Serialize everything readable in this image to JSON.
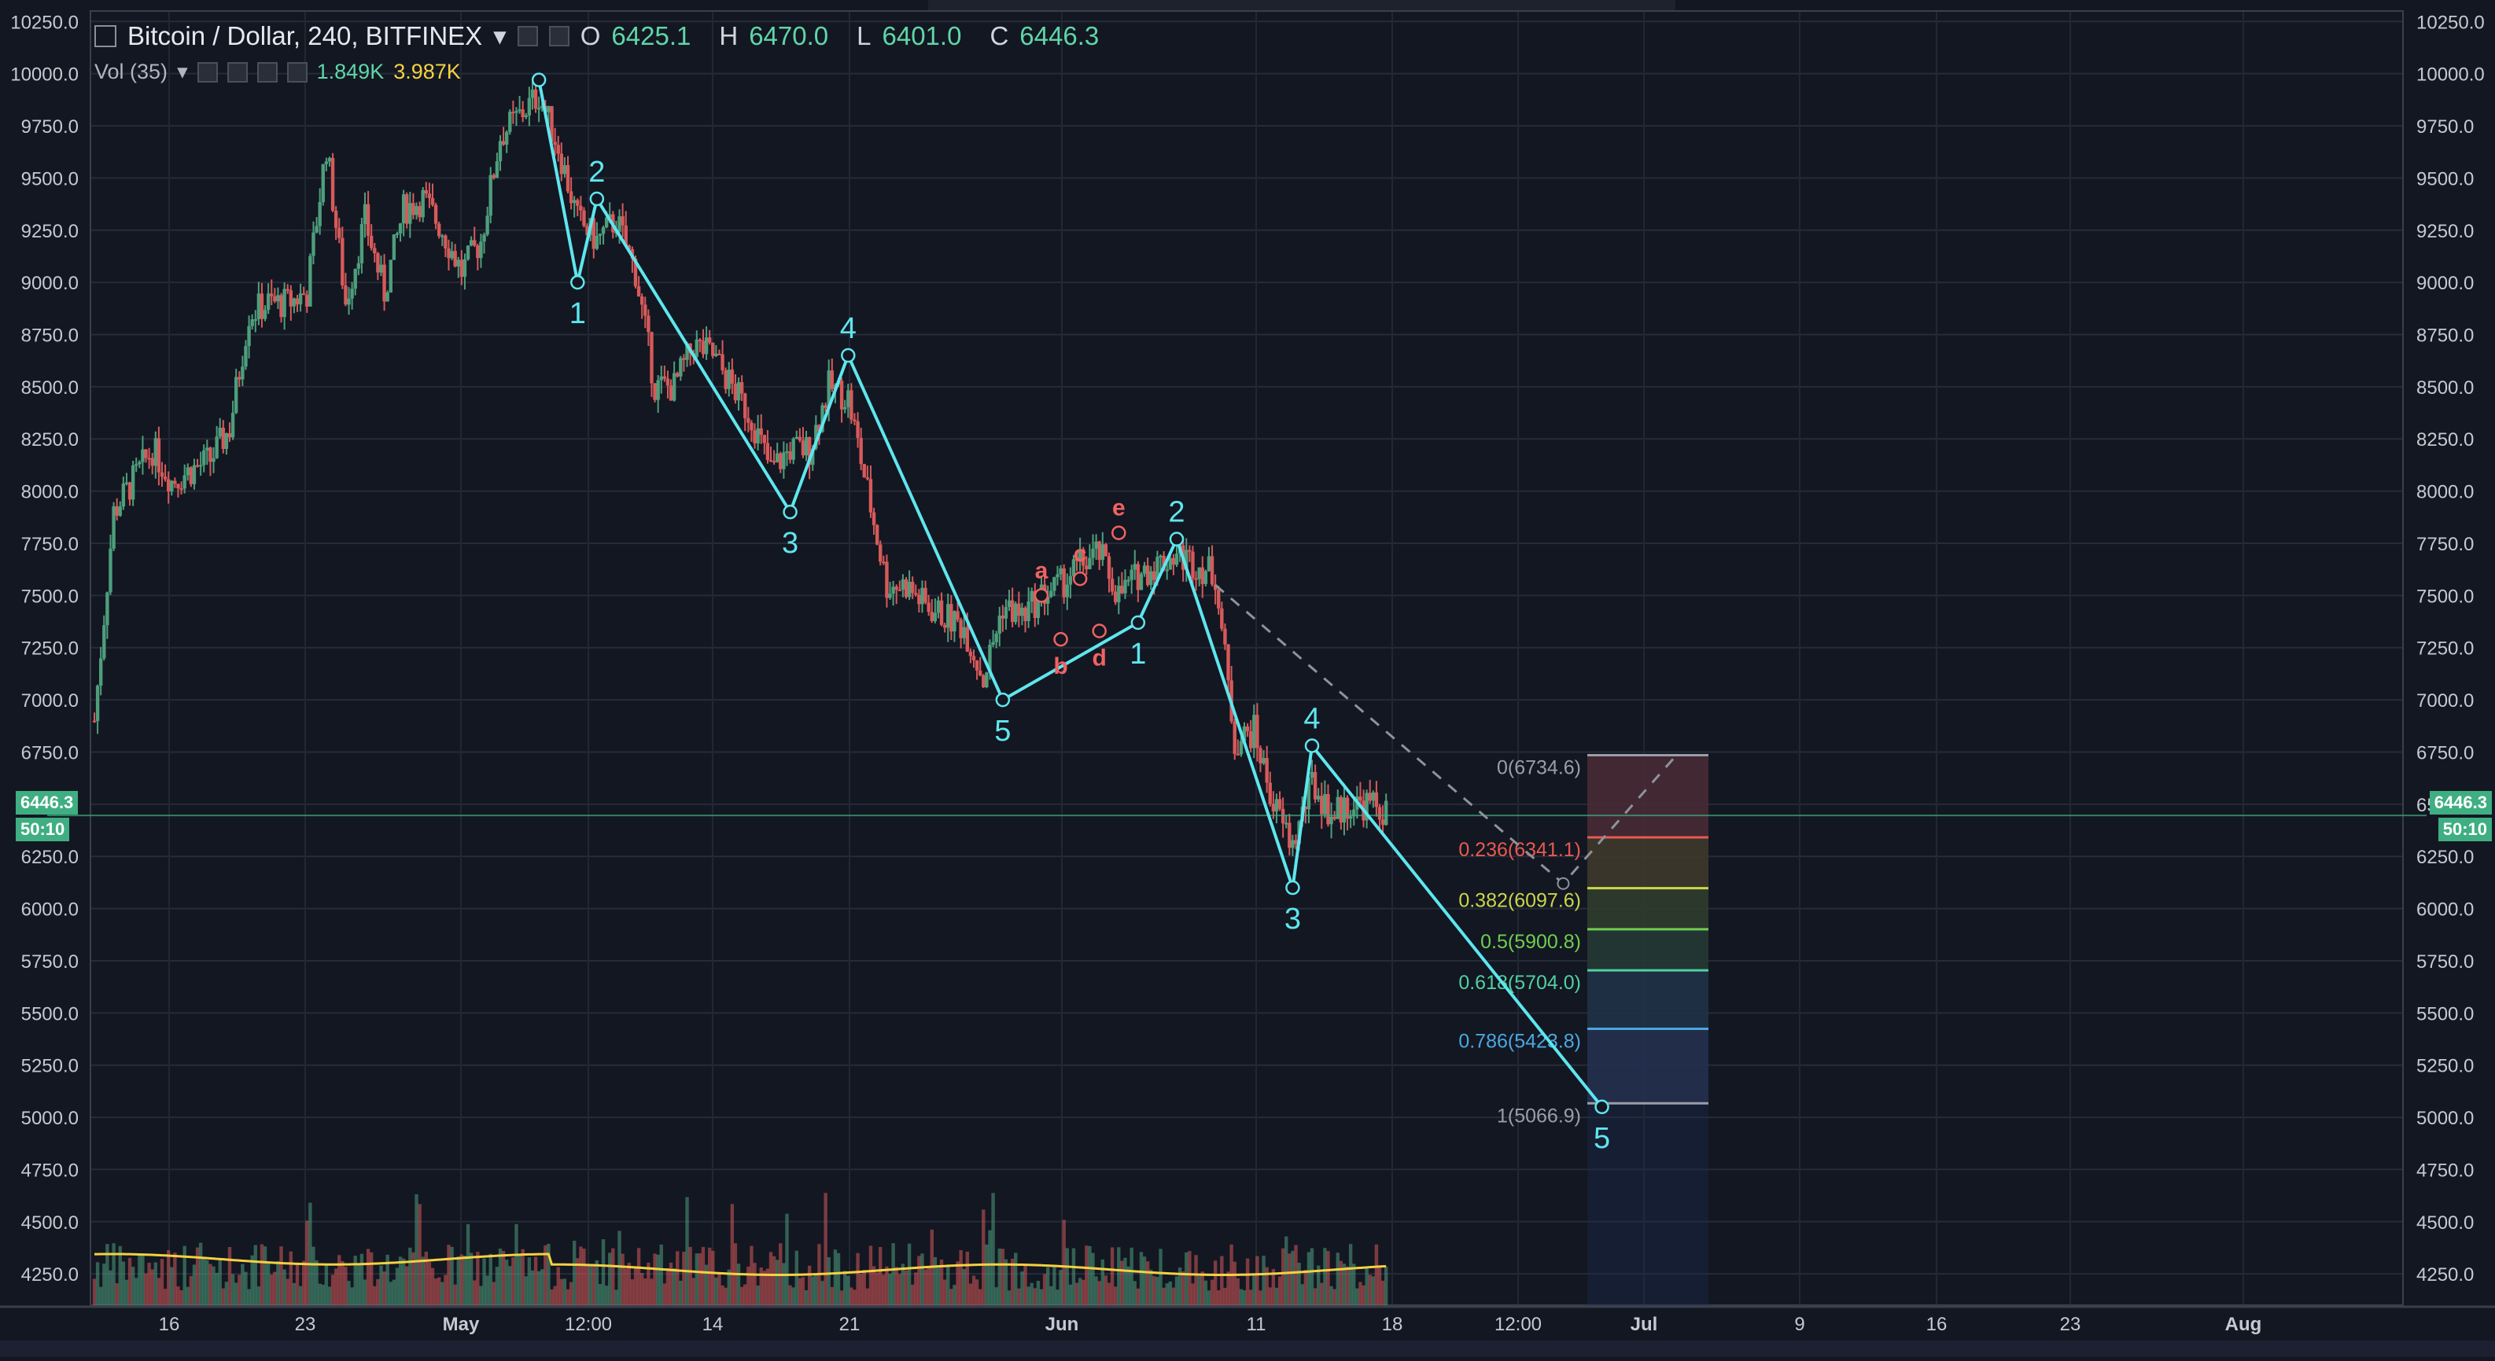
{
  "header": {
    "symbol": "Bitcoin / Dollar, 240, BITFINEX",
    "open_label": "O",
    "open": "6425.1",
    "high_label": "H",
    "high": "6470.0",
    "low_label": "L",
    "low": "6401.0",
    "close_label": "C",
    "close": "6446.3"
  },
  "volume": {
    "label": "Vol (35)",
    "value": "1.849K",
    "ma": "3.987K"
  },
  "price_tag": {
    "price": "6446.3",
    "countdown": "50:10"
  },
  "colors": {
    "background": "#131722",
    "up": "#4e9e7c",
    "down": "#d65a5a",
    "wave": "#5ee6ee",
    "correction": "#f06262",
    "volume_ma": "#f5d142"
  },
  "chart_data": {
    "type": "candlestick",
    "y_ticks": [
      "10250.0",
      "10000.0",
      "9750.0",
      "9500.0",
      "9250.0",
      "9000.0",
      "8750.0",
      "8500.0",
      "8250.0",
      "8000.0",
      "7750.0",
      "7500.0",
      "7250.0",
      "7000.0",
      "6750.0",
      "6500.0",
      "6250.0",
      "6000.0",
      "5750.0",
      "5500.0",
      "5250.0",
      "5000.0",
      "4750.0",
      "4500.0",
      "4250.0"
    ],
    "ylim": [
      4100,
      10300
    ],
    "x_ticks": [
      "16",
      "23",
      "May",
      "12:00",
      "14",
      "21",
      "Jun",
      "11",
      "18",
      "12:00",
      "Jul",
      "9",
      "16",
      "23",
      "Aug"
    ],
    "price_path": [
      [
        "Apr 12",
        6900
      ],
      [
        "Apr 13",
        7900
      ],
      [
        "Apr 14",
        8050
      ],
      [
        "Apr 15",
        8200
      ],
      [
        "Apr 16",
        8050
      ],
      [
        "Apr 17",
        8100
      ],
      [
        "Apr 18",
        8150
      ],
      [
        "Apr 19",
        8300
      ],
      [
        "Apr 20",
        8850
      ],
      [
        "Apr 21",
        8900
      ],
      [
        "Apr 22",
        8900
      ],
      [
        "Apr 23",
        8950
      ],
      [
        "Apr 24",
        9650
      ],
      [
        "Apr 25",
        8900
      ],
      [
        "Apr 26",
        9300
      ],
      [
        "Apr 27",
        8950
      ],
      [
        "Apr 28",
        9350
      ],
      [
        "Apr 29",
        9400
      ],
      [
        "Apr 30",
        9250
      ],
      [
        "May 1",
        9050
      ],
      [
        "May 2",
        9200
      ],
      [
        "May 3",
        9700
      ],
      [
        "May 4",
        9800
      ],
      [
        "May 5",
        9900
      ],
      [
        "May 6",
        9650
      ],
      [
        "May 7",
        9300
      ],
      [
        "May 8",
        9200
      ],
      [
        "May 9",
        9300
      ],
      [
        "May 10",
        9050
      ],
      [
        "May 11",
        8500
      ],
      [
        "May 12",
        8500
      ],
      [
        "May 13",
        8700
      ],
      [
        "May 14",
        8650
      ],
      [
        "May 15",
        8500
      ],
      [
        "May 16",
        8350
      ],
      [
        "May 17",
        8100
      ],
      [
        "May 18",
        8200
      ],
      [
        "May 19",
        8200
      ],
      [
        "May 20",
        8500
      ],
      [
        "May 21",
        8450
      ],
      [
        "May 22",
        8000
      ],
      [
        "May 23",
        7550
      ],
      [
        "May 24",
        7550
      ],
      [
        "May 25",
        7450
      ],
      [
        "May 26",
        7400
      ],
      [
        "May 27",
        7350
      ],
      [
        "May 28",
        7100
      ],
      [
        "May 29",
        7450
      ],
      [
        "May 30",
        7400
      ],
      [
        "May 31",
        7500
      ],
      [
        "Jun 1",
        7550
      ],
      [
        "Jun 2",
        7650
      ],
      [
        "Jun 3",
        7700
      ],
      [
        "Jun 4",
        7500
      ],
      [
        "Jun 5",
        7600
      ],
      [
        "Jun 6",
        7650
      ],
      [
        "Jun 7",
        7700
      ],
      [
        "Jun 8",
        7650
      ],
      [
        "Jun 9",
        7600
      ],
      [
        "Jun 10",
        6800
      ],
      [
        "Jun 11",
        6850
      ],
      [
        "Jun 12",
        6500
      ],
      [
        "Jun 13",
        6300
      ],
      [
        "Jun 14",
        6600
      ],
      [
        "Jun 15",
        6450
      ],
      [
        "Jun 16",
        6500
      ],
      [
        "Jun 17",
        6500
      ],
      [
        "Jun 18",
        6446
      ]
    ],
    "elliott_waves": [
      {
        "label": "1",
        "date": "May 7",
        "price": 9000
      },
      {
        "label": "2",
        "date": "May 8",
        "price": 9400
      },
      {
        "label": "3",
        "date": "May 18",
        "price": 7900
      },
      {
        "label": "4",
        "date": "May 21",
        "price": 8650
      },
      {
        "label": "5",
        "date": "May 29",
        "price": 7000
      },
      {
        "label": "1",
        "date": "Jun 5",
        "price": 7370
      },
      {
        "label": "2",
        "date": "Jun 7",
        "price": 7770
      },
      {
        "label": "3",
        "date": "Jun 13",
        "price": 6100
      },
      {
        "label": "4",
        "date": "Jun 14",
        "price": 6780
      },
      {
        "label": "5",
        "date": "Jun 29",
        "price": 5050
      }
    ],
    "wave_top_point": {
      "date": "May 5",
      "price": 9970
    },
    "correction_labels": [
      {
        "label": "a",
        "date": "May 31",
        "price": 7500
      },
      {
        "label": "b",
        "date": "Jun 1",
        "price": 7290
      },
      {
        "label": "c",
        "date": "Jun 2",
        "price": 7580
      },
      {
        "label": "d",
        "date": "Jun 3",
        "price": 7330
      },
      {
        "label": "e",
        "date": "Jun 4",
        "price": 7800
      }
    ],
    "fibonacci": {
      "levels": [
        {
          "label": "0(6734.6)",
          "value": 6734.6,
          "color": "#9a9ea8"
        },
        {
          "label": "0.236(6341.1)",
          "value": 6341.1,
          "color": "#e85a4f"
        },
        {
          "label": "0.382(6097.6)",
          "value": 6097.6,
          "color": "#c9d64a"
        },
        {
          "label": "0.5(5900.8)",
          "value": 5900.8,
          "color": "#6fce50"
        },
        {
          "label": "0.618(5704.0)",
          "value": 5704.0,
          "color": "#4fd0a0"
        },
        {
          "label": "0.786(5423.8)",
          "value": 5423.8,
          "color": "#4aa8e0"
        },
        {
          "label": "1(5066.9)",
          "value": 5066.9,
          "color": "#9a9ea8"
        }
      ]
    },
    "projection": {
      "trend_from": [
        "Jun 9",
        7550
      ],
      "trend_to": [
        "Jun 27",
        6120
      ],
      "return_to": [
        "Jul 3",
        6750
      ]
    }
  }
}
